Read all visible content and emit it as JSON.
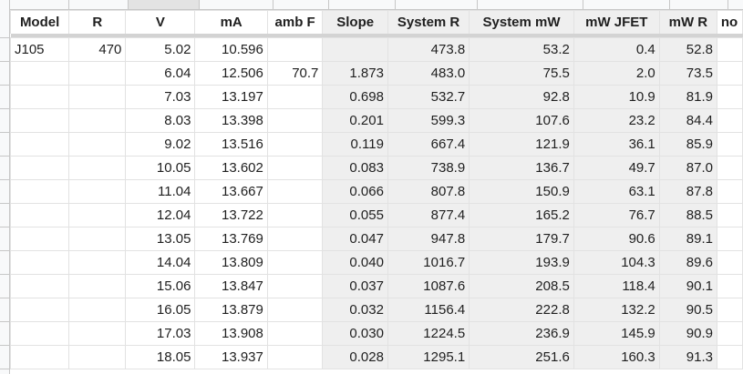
{
  "sheet": {
    "headers": [
      "Model",
      "R",
      "V",
      "mA",
      "amb F",
      "Slope",
      "System R",
      "System mW",
      "mW JFET",
      "mW R",
      "no"
    ],
    "rows": [
      [
        "J105",
        "470",
        "5.02",
        "10.596",
        "",
        "",
        "473.8",
        "53.2",
        "0.4",
        "52.8",
        ""
      ],
      [
        "",
        "",
        "6.04",
        "12.506",
        "70.7",
        "1.873",
        "483.0",
        "75.5",
        "2.0",
        "73.5",
        ""
      ],
      [
        "",
        "",
        "7.03",
        "13.197",
        "",
        "0.698",
        "532.7",
        "92.8",
        "10.9",
        "81.9",
        ""
      ],
      [
        "",
        "",
        "8.03",
        "13.398",
        "",
        "0.201",
        "599.3",
        "107.6",
        "23.2",
        "84.4",
        ""
      ],
      [
        "",
        "",
        "9.02",
        "13.516",
        "",
        "0.119",
        "667.4",
        "121.9",
        "36.1",
        "85.9",
        ""
      ],
      [
        "",
        "",
        "10.05",
        "13.602",
        "",
        "0.083",
        "738.9",
        "136.7",
        "49.7",
        "87.0",
        ""
      ],
      [
        "",
        "",
        "11.04",
        "13.667",
        "",
        "0.066",
        "807.8",
        "150.9",
        "63.1",
        "87.8",
        ""
      ],
      [
        "",
        "",
        "12.04",
        "13.722",
        "",
        "0.055",
        "877.4",
        "165.2",
        "76.7",
        "88.5",
        ""
      ],
      [
        "",
        "",
        "13.05",
        "13.769",
        "",
        "0.047",
        "947.8",
        "179.7",
        "90.6",
        "89.1",
        ""
      ],
      [
        "",
        "",
        "14.04",
        "13.809",
        "",
        "0.040",
        "1016.7",
        "193.9",
        "104.3",
        "89.6",
        ""
      ],
      [
        "",
        "",
        "15.06",
        "13.847",
        "",
        "0.037",
        "1087.6",
        "208.5",
        "118.4",
        "90.1",
        ""
      ],
      [
        "",
        "",
        "16.05",
        "13.879",
        "",
        "0.032",
        "1156.4",
        "222.8",
        "132.2",
        "90.5",
        ""
      ],
      [
        "",
        "",
        "17.03",
        "13.908",
        "",
        "0.030",
        "1224.5",
        "236.9",
        "145.9",
        "90.9",
        ""
      ],
      [
        "",
        "",
        "18.05",
        "13.937",
        "",
        "0.028",
        "1295.1",
        "251.6",
        "160.3",
        "91.3",
        ""
      ]
    ]
  },
  "colors": {
    "computed_column_fill": "#efefef",
    "freeze_bar": "#d3d3d3",
    "grid_line": "#e2e2e2"
  }
}
